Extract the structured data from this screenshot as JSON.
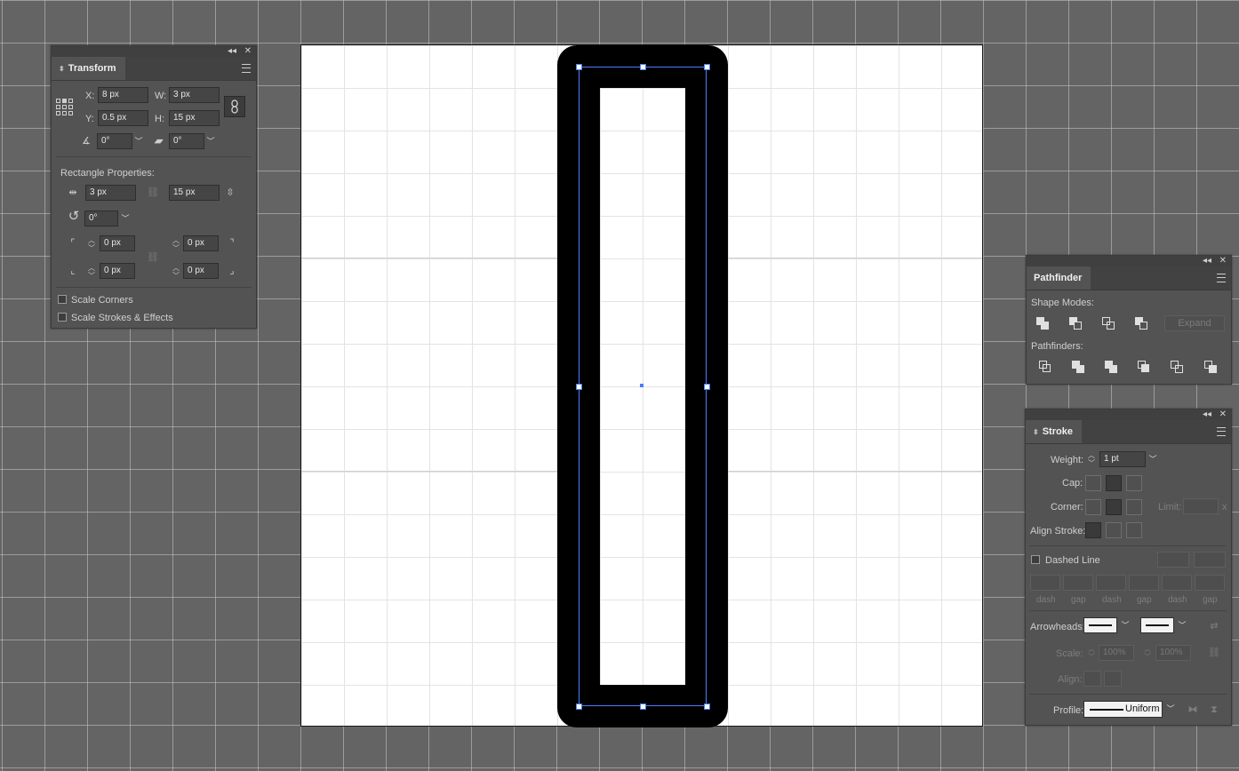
{
  "transform_panel": {
    "tab": "Transform",
    "x_label": "X:",
    "x_value": "8 px",
    "y_label": "Y:",
    "y_value": "0.5 px",
    "w_label": "W:",
    "w_value": "3 px",
    "h_label": "H:",
    "h_value": "15 px",
    "rotate_value": "0°",
    "shear_value": "0°",
    "rect_props_label": "Rectangle Properties:",
    "rect_width": "3 px",
    "rect_height": "15 px",
    "rect_rotate": "0°",
    "corner_tl": "0 px",
    "corner_tr": "0 px",
    "corner_bl": "0 px",
    "corner_br": "0 px",
    "scale_corners": "Scale Corners",
    "scale_strokes": "Scale Strokes & Effects"
  },
  "pathfinder_panel": {
    "tab": "Pathfinder",
    "shape_modes_label": "Shape Modes:",
    "expand_label": "Expand",
    "pathfinders_label": "Pathfinders:"
  },
  "stroke_panel": {
    "tab": "Stroke",
    "weight_label": "Weight:",
    "weight_value": "1 pt",
    "cap_label": "Cap:",
    "corner_label": "Corner:",
    "limit_label": "Limit:",
    "limit_suffix": "x",
    "align_label": "Align Stroke:",
    "dashed_label": "Dashed Line",
    "dash_labels": [
      "dash",
      "gap",
      "dash",
      "gap",
      "dash",
      "gap"
    ],
    "arrowheads_label": "Arrowheads:",
    "scale_label": "Scale:",
    "scale_start": "100%",
    "scale_end": "100%",
    "align_arrow_label": "Align:",
    "profile_label": "Profile:",
    "profile_value": "Uniform"
  },
  "colors": {
    "canvas": "#646464",
    "panel": "#535353",
    "selection": "#4a7cff",
    "shape": "#000000"
  }
}
